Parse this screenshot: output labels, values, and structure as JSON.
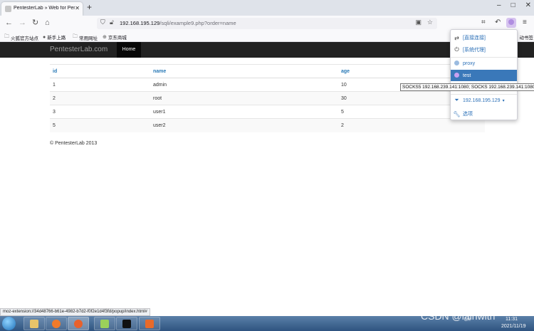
{
  "browser": {
    "tab_title": "PentesterLab » Web for Pent",
    "url_host": "192.168.195.129",
    "url_path": "/sqli/example9.php?order=name",
    "bookmarks": [
      "火狐官方站点",
      "新手上路",
      "常用网址",
      "京东商城"
    ],
    "bookmarks_right": "动书签",
    "status_url": "moz-extension://34d48766-b61e-4982-b7d2-f0f2e1d4f3fd/popup/index.html#"
  },
  "site": {
    "brand": "PentesterLab.com",
    "nav_home": "Home",
    "footer": "© PentesterLab 2013"
  },
  "table": {
    "columns": [
      "id",
      "name",
      "age"
    ],
    "rows": [
      {
        "id": "1",
        "name": "admin",
        "age": "10"
      },
      {
        "id": "2",
        "name": "root",
        "age": "30"
      },
      {
        "id": "3",
        "name": "user1",
        "age": "5"
      },
      {
        "id": "5",
        "name": "user2",
        "age": "2"
      }
    ]
  },
  "proxy_popup": {
    "direct": "[直接连接]",
    "system": "[系统代理]",
    "profile_proxy": "proxy",
    "profile_test": "test",
    "host_label": "192.168.195.129",
    "options": "选项",
    "tooltip": "SOCKS5 192.168.239.141:1080; SOCKS 192.168.239.141:1080"
  },
  "taskbar": {
    "tray_text": "CH",
    "time": "11:31",
    "date": "2021/11/19",
    "watermark": "CSDN @lainwith"
  },
  "colors": {
    "accent": "#3a78b9",
    "link": "#2a7ab7",
    "header_bg": "#222222"
  }
}
